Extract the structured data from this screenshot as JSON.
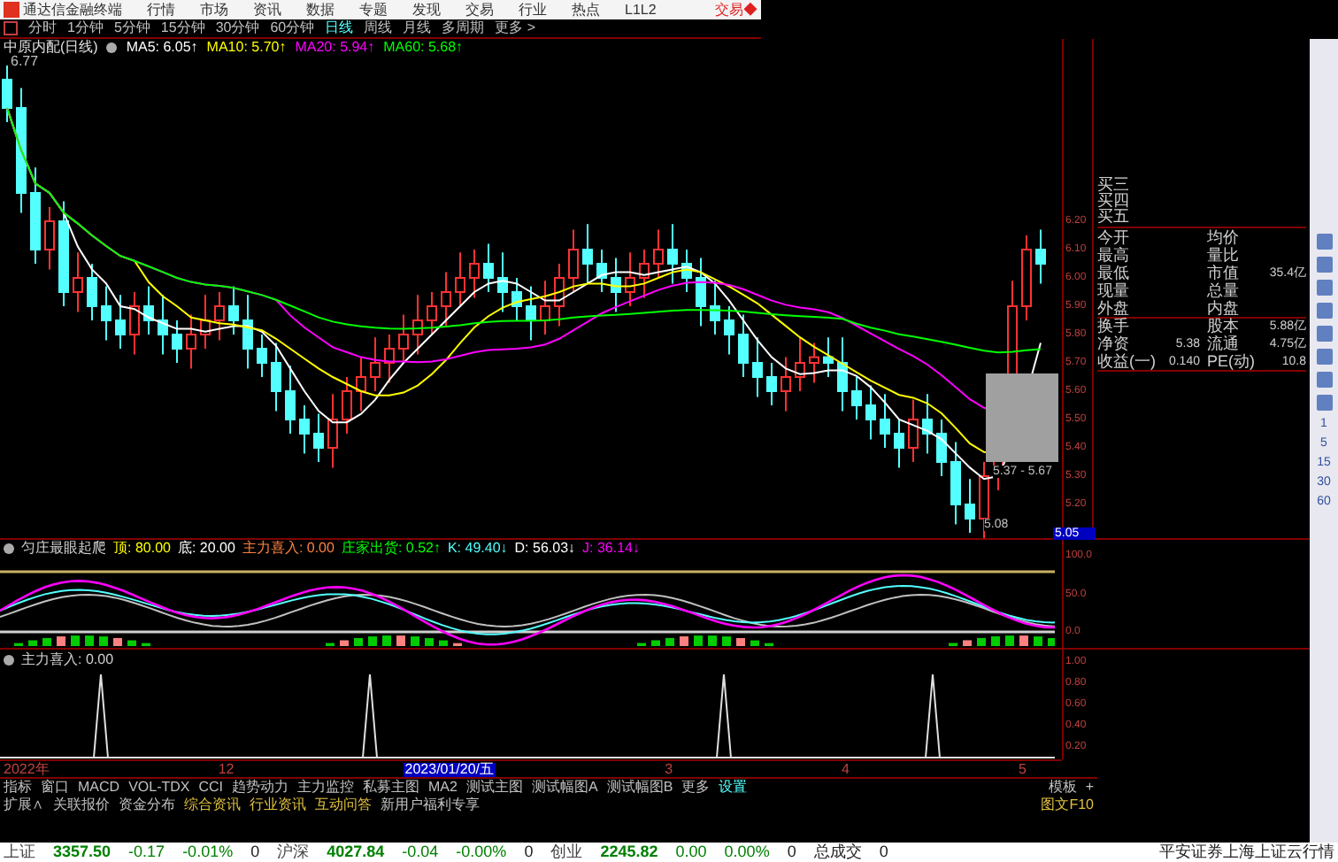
{
  "top_menu": {
    "app_title": "通达信金融终端",
    "items": [
      "行情",
      "市场",
      "资讯",
      "数据",
      "专题",
      "发现",
      "交易",
      "行业",
      "热点",
      "L1L2"
    ],
    "trade_button": "交易◆"
  },
  "periods": [
    {
      "label": "分时",
      "selected": false
    },
    {
      "label": "1分钟",
      "selected": false
    },
    {
      "label": "5分钟",
      "selected": false
    },
    {
      "label": "15分钟",
      "selected": false
    },
    {
      "label": "30分钟",
      "selected": false
    },
    {
      "label": "60分钟",
      "selected": false
    },
    {
      "label": "日线",
      "selected": true
    },
    {
      "label": "周线",
      "selected": false
    },
    {
      "label": "月线",
      "selected": false
    },
    {
      "label": "多周期",
      "selected": false
    },
    {
      "label": "更多 >",
      "selected": false
    }
  ],
  "legend": {
    "stock": "中原内配(日线)",
    "ma": [
      {
        "label": "MA5: 6.05↑",
        "color": "#ffffff"
      },
      {
        "label": "MA10: 5.70↑",
        "color": "#ffff00"
      },
      {
        "label": "MA20: 5.94↑",
        "color": "#ff00ff"
      },
      {
        "label": "MA60: 5.68↑",
        "color": "#00ff00"
      }
    ]
  },
  "chart": {
    "high_label": "6.77",
    "low_label": "5.08",
    "range_label": "5.37 - 5.67",
    "price_ticks": [
      "6.20",
      "6.10",
      "6.00",
      "5.90",
      "5.80",
      "5.70",
      "5.60",
      "5.50",
      "5.40",
      "5.30",
      "5.20"
    ],
    "cursor_price": "5.05"
  },
  "quote_panel": {
    "bids": [
      "买三",
      "买四",
      "买五"
    ],
    "rows": [
      {
        "label1": "今开",
        "value1": "",
        "label2": "均价",
        "value2": ""
      },
      {
        "label1": "最高",
        "value1": "",
        "label2": "量比",
        "value2": ""
      },
      {
        "label1": "最低",
        "value1": "",
        "label2": "市值",
        "value2": "35.4亿"
      },
      {
        "label1": "现量",
        "value1": "",
        "label2": "总量",
        "value2": ""
      },
      {
        "label1": "外盘",
        "value1": "",
        "label2": "内盘",
        "value2": ""
      },
      {
        "label1": "换手",
        "value1": "",
        "label2": "股本",
        "value2": "5.88亿"
      },
      {
        "label1": "净资",
        "value1": "5.38",
        "label2": "流通",
        "value2": "4.75亿"
      },
      {
        "label1": "收益(一)",
        "value1": "0.140",
        "label2": "PE(动)",
        "value2": "10.8"
      }
    ]
  },
  "side_toolbar": {
    "periods": [
      "1",
      "5",
      "15",
      "30",
      "60"
    ]
  },
  "indicator1": {
    "title": "匀庄最眼起爬",
    "values": [
      {
        "label": "顶: 80.00",
        "color": "#ffff00"
      },
      {
        "label": "底: 20.00",
        "color": "#ffffff"
      },
      {
        "label": "主力喜入: 0.00",
        "color": "#ff8040"
      },
      {
        "label": "庄家出货: 0.52↑",
        "color": "#00ff00"
      },
      {
        "label": "K: 49.40↓",
        "color": "#54ffff"
      },
      {
        "label": "D: 56.03↓",
        "color": "#ffffff"
      },
      {
        "label": "J: 36.14↓",
        "color": "#ff00ff"
      }
    ],
    "axis": [
      "100.0",
      "50.0",
      "0.0"
    ]
  },
  "indicator2": {
    "title": "主力喜入: 0.00",
    "axis": [
      "1.00",
      "0.80",
      "0.60",
      "0.40",
      "0.20"
    ]
  },
  "date_axis": [
    {
      "label": "2022年",
      "selected": false
    },
    {
      "label": "12",
      "selected": false
    },
    {
      "label": "2023/01/20/五",
      "selected": true
    },
    {
      "label": "3",
      "selected": false
    },
    {
      "label": "4",
      "selected": false
    },
    {
      "label": "5",
      "selected": false
    }
  ],
  "indicator_tabs": [
    {
      "label": "指标",
      "selected": false
    },
    {
      "label": "窗口",
      "selected": false
    },
    {
      "label": "MACD",
      "selected": false
    },
    {
      "label": "VOL-TDX",
      "selected": false
    },
    {
      "label": "CCI",
      "selected": false
    },
    {
      "label": "趋势动力",
      "selected": false
    },
    {
      "label": "主力监控",
      "selected": false
    },
    {
      "label": "私募主图",
      "selected": false
    },
    {
      "label": "MA2",
      "selected": false
    },
    {
      "label": "测试主图",
      "selected": false
    },
    {
      "label": "测试幅图A",
      "selected": false
    },
    {
      "label": "测试幅图B",
      "selected": false
    },
    {
      "label": "更多",
      "selected": false
    },
    {
      "label": "设置",
      "selected": true
    }
  ],
  "template_button": "模板",
  "add_button": "+",
  "info_tabs": [
    {
      "label": "扩展∧",
      "color": "#c0c0c0"
    },
    {
      "label": "关联报价",
      "color": "#c0c0c0"
    },
    {
      "label": "资金分布",
      "color": "#c0c0c0"
    },
    {
      "label": "综合资讯",
      "color": "#e0c040"
    },
    {
      "label": "行业资讯",
      "color": "#e0c040"
    },
    {
      "label": "互动问答",
      "color": "#e0c040"
    },
    {
      "label": "新用户福利专享",
      "color": "#c0c0c0"
    }
  ],
  "f10_button": "图文F10",
  "status_bar": {
    "indices": [
      {
        "name": "上证",
        "price": "3357.50",
        "change": "-0.17",
        "percent": "-0.01%",
        "volume": "0"
      },
      {
        "name": "沪深",
        "price": "4027.84",
        "change": "-0.04",
        "percent": "-0.00%",
        "volume": "0"
      },
      {
        "name": "创业",
        "price": "2245.82",
        "change": "0.00",
        "percent": "0.00%",
        "volume": "0"
      }
    ],
    "total_label": "总成交",
    "total_value": "0",
    "feed": "平安证券上海上证云行情"
  }
}
